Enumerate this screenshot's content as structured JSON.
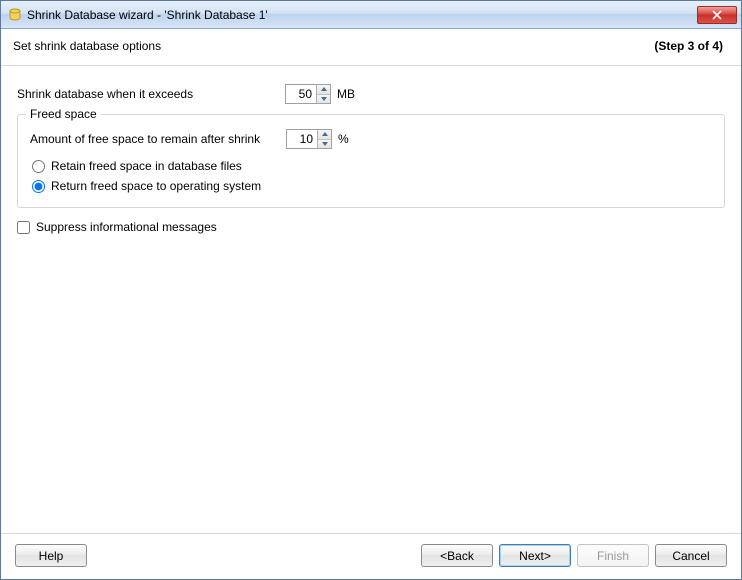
{
  "window": {
    "title": "Shrink Database wizard - 'Shrink Database 1'"
  },
  "header": {
    "title": "Set shrink database options",
    "step": "(Step 3 of 4)"
  },
  "fields": {
    "threshold_label": "Shrink database when it exceeds",
    "threshold_value": "50",
    "threshold_unit": "MB"
  },
  "group": {
    "title": "Freed space",
    "freespace_label": "Amount of free space to remain after shrink",
    "freespace_value": "10",
    "freespace_unit": "%",
    "radio_retain": "Retain freed space in database files",
    "radio_return": "Return freed space to operating system",
    "selected": "return"
  },
  "suppress": {
    "label": "Suppress informational messages",
    "checked": false
  },
  "buttons": {
    "help": "Help",
    "back": "<Back",
    "next": "Next>",
    "finish": "Finish",
    "cancel": "Cancel"
  }
}
